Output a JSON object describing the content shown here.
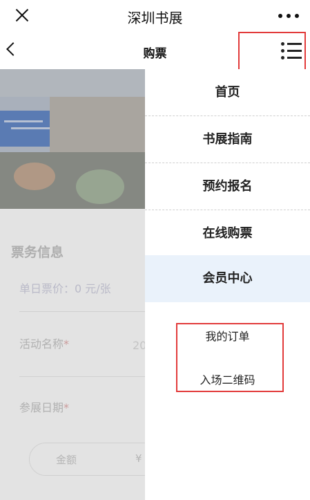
{
  "topbar": {
    "title": "深圳书展",
    "close_icon": "close-icon",
    "more_icon": "more-icon"
  },
  "subbar": {
    "title": "购票",
    "back_icon": "chevron-left-icon",
    "menu_icon": "menu-list-icon"
  },
  "background_page": {
    "section_title": "票务信息",
    "price_text": "单日票价：0 元/张",
    "fields": [
      {
        "label": "活动名称",
        "required_mark": "*",
        "value_fragment": "20"
      },
      {
        "label": "参展日期",
        "required_mark": "*"
      }
    ],
    "amount": {
      "label": "金额",
      "currency": "¥"
    }
  },
  "drawer": {
    "items": [
      {
        "label": "首页"
      },
      {
        "label": "书展指南"
      },
      {
        "label": "预约报名"
      },
      {
        "label": "在线购票"
      },
      {
        "label": "会员中心",
        "active": true
      }
    ],
    "sub_items": [
      {
        "label": "我的订单"
      },
      {
        "label": "入场二维码"
      }
    ]
  },
  "colors": {
    "highlight_border": "#e23a3a",
    "active_bg": "#eaf2fb"
  }
}
